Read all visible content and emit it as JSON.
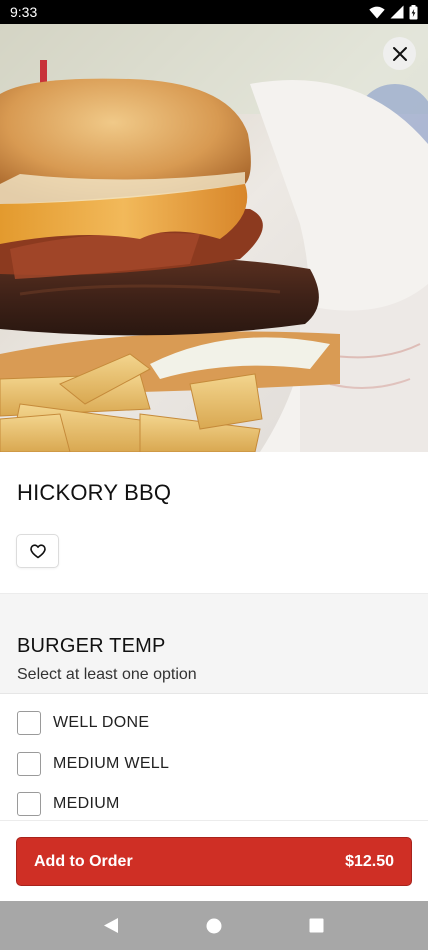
{
  "status_bar": {
    "time": "9:33",
    "icons": [
      "wifi-icon",
      "signal-icon",
      "battery-icon"
    ]
  },
  "hero": {
    "image_subject": "burger-with-fries",
    "close_icon": "close-icon"
  },
  "item": {
    "title": "HICKORY BBQ",
    "favorite_icon": "heart-outline-icon"
  },
  "options": {
    "title": "BURGER TEMP",
    "subtitle": "Select at least one option",
    "choices": [
      {
        "label": "WELL DONE",
        "checked": false
      },
      {
        "label": "MEDIUM WELL",
        "checked": false
      },
      {
        "label": "MEDIUM",
        "checked": false
      }
    ]
  },
  "footer": {
    "add_label": "Add to Order",
    "price": "$12.50"
  },
  "nav": {
    "icons": [
      "back-triangle-icon",
      "home-circle-icon",
      "recents-square-icon"
    ]
  },
  "colors": {
    "accent": "#cf2f25",
    "status_bar": "#000000",
    "nav_bar": "#a7a7a7",
    "section_bg": "#f5f5f5"
  }
}
